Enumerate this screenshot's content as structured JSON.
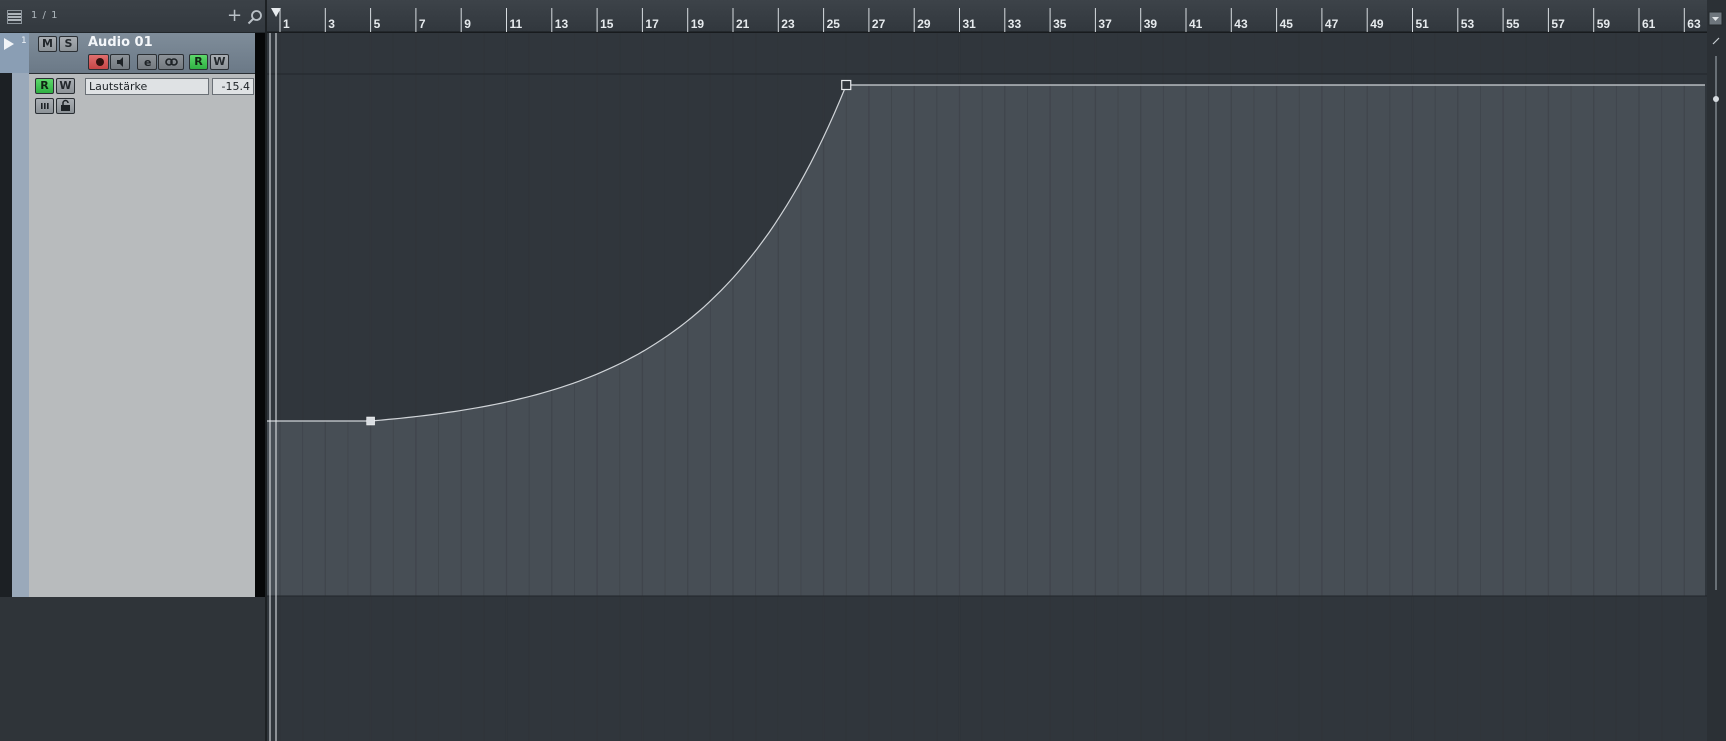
{
  "header": {
    "track_count": "1 / 1",
    "add_track_symbol": "+",
    "icons": [
      "track-list-menu-icon",
      "add-track-icon",
      "search-icon"
    ]
  },
  "track": {
    "number": "1",
    "name": "Audio 01",
    "mute_label": "M",
    "solo_label": "S",
    "read_label": "R",
    "write_label": "W",
    "color": "#9aa9ba",
    "icons": [
      "record-enable-icon",
      "monitor-icon",
      "edit-channel-icon",
      "link-icon",
      "expand-triangle-icon"
    ]
  },
  "automation": {
    "read_label": "R",
    "write_label": "W",
    "parameter": "Lautstärke",
    "value": "-15.4",
    "icons": [
      "show-automation-lanes-icon",
      "lock-icon"
    ]
  },
  "ruler": {
    "bars": [
      "1",
      "3",
      "5",
      "7",
      "9",
      "11",
      "13",
      "15",
      "17",
      "19",
      "21",
      "23",
      "25",
      "27",
      "29",
      "31",
      "33",
      "35",
      "37",
      "39",
      "41",
      "43",
      "45",
      "47",
      "49",
      "51",
      "53",
      "55",
      "57",
      "59",
      "61",
      "63"
    ]
  },
  "curve": {
    "start_value": 0.35,
    "end_value": 1.0,
    "point1_bar": 5,
    "point2_bar": 26,
    "shape": "exponential-rise"
  },
  "colors": {
    "accent_green": "#3cc451",
    "record_red": "#d75656",
    "curve_line": "#d0d4d8",
    "fill": "#4a5058"
  }
}
